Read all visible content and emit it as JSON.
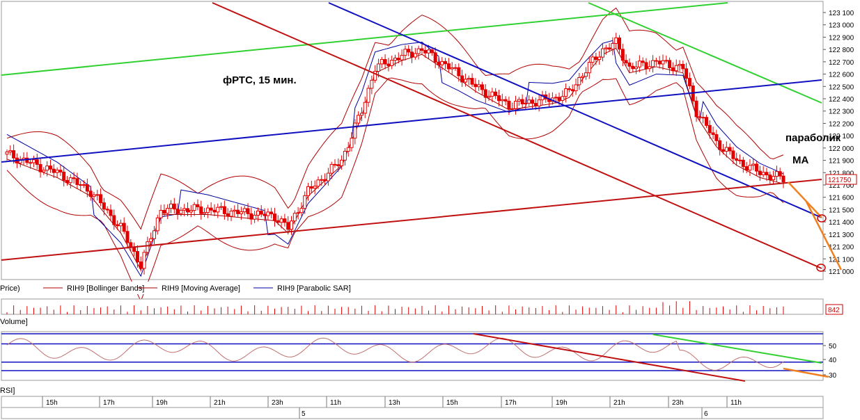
{
  "chart_data": {
    "type": "candlestick",
    "instrument": "RIH9",
    "annotations": {
      "title": "фРТС,  15 мин.",
      "parabolic": "параболик",
      "ma": "MA"
    },
    "price_axis": {
      "ticks": [
        123100,
        123000,
        122900,
        122800,
        122700,
        122600,
        122500,
        122400,
        122300,
        122200,
        122100,
        122000,
        121900,
        121800,
        121700,
        121600,
        121500,
        121400,
        121300,
        121200,
        121100,
        121000
      ],
      "ylim": [
        120980,
        123130
      ],
      "last_value": 121750
    },
    "legend": {
      "price": "Price)",
      "bb": "RIH9 [Bollinger Bands]",
      "ma": "RIH9 [Moving Average]",
      "sar": "RIH9 [Parabolic SAR]"
    },
    "volume_panel": {
      "label": "Volume]",
      "last_value": "842"
    },
    "rsi_panel": {
      "label": "RSI]",
      "ticks": [
        50,
        40,
        30
      ]
    },
    "time_axis": {
      "labels": [
        "15h",
        "17h",
        "19h",
        "21h",
        "23h",
        "11h",
        "13h",
        "15h",
        "17h",
        "19h",
        "21h",
        "23h",
        "11h"
      ],
      "days": [
        "5",
        "6"
      ]
    },
    "colors": {
      "candle": "#e00000",
      "bollinger": "#b00000",
      "ma": "#a00000",
      "sar": "#0000a0",
      "green_channel": "#30d030",
      "blue_trend": "#1010c0",
      "red_trend": "#c01010",
      "forecast": "#f08020",
      "rsi": "#c07070"
    }
  }
}
